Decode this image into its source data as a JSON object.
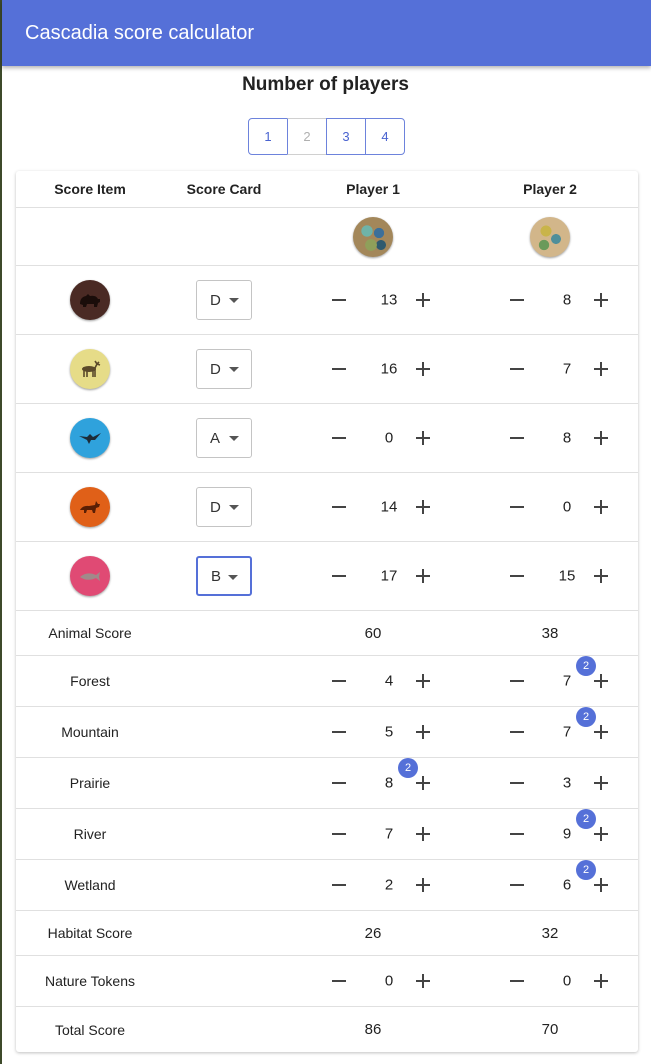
{
  "app": {
    "title": "Cascadia score calculator"
  },
  "players_selector": {
    "title": "Number of players",
    "options": [
      "1",
      "2",
      "3",
      "4"
    ],
    "selected": "2"
  },
  "table": {
    "headers": {
      "score_item": "Score Item",
      "score_card": "Score Card",
      "player1": "Player 1",
      "player2": "Player 2"
    },
    "animals": [
      {
        "icon": "bear-icon",
        "color": "#4a2a24",
        "card": "D",
        "p1": "13",
        "p2": "8"
      },
      {
        "icon": "elk-icon",
        "color": "#e6dc88",
        "card": "D",
        "p1": "16",
        "p2": "7"
      },
      {
        "icon": "hawk-icon",
        "color": "#2fa2dc",
        "card": "A",
        "p1": "0",
        "p2": "8"
      },
      {
        "icon": "fox-icon",
        "color": "#e06018",
        "card": "D",
        "p1": "14",
        "p2": "0"
      },
      {
        "icon": "salmon-icon",
        "color": "#e04a74",
        "card": "B",
        "p1": "17",
        "p2": "15"
      }
    ],
    "animal_score": {
      "label": "Animal Score",
      "p1": "60",
      "p2": "38"
    },
    "habitats": [
      {
        "label": "Forest",
        "p1": "4",
        "p2": "7",
        "p1_badge": "",
        "p2_badge": "2"
      },
      {
        "label": "Mountain",
        "p1": "5",
        "p2": "7",
        "p1_badge": "",
        "p2_badge": "2"
      },
      {
        "label": "Prairie",
        "p1": "8",
        "p2": "3",
        "p1_badge": "2",
        "p2_badge": ""
      },
      {
        "label": "River",
        "p1": "7",
        "p2": "9",
        "p1_badge": "",
        "p2_badge": "2"
      },
      {
        "label": "Wetland",
        "p1": "2",
        "p2": "6",
        "p1_badge": "",
        "p2_badge": "2"
      }
    ],
    "habitat_score": {
      "label": "Habitat Score",
      "p1": "26",
      "p2": "32"
    },
    "nature_tokens": {
      "label": "Nature Tokens",
      "p1": "0",
      "p2": "0"
    },
    "total_score": {
      "label": "Total Score",
      "p1": "86",
      "p2": "70"
    }
  },
  "colors": {
    "accent": "#5570d8",
    "badge": "#5570d8"
  }
}
